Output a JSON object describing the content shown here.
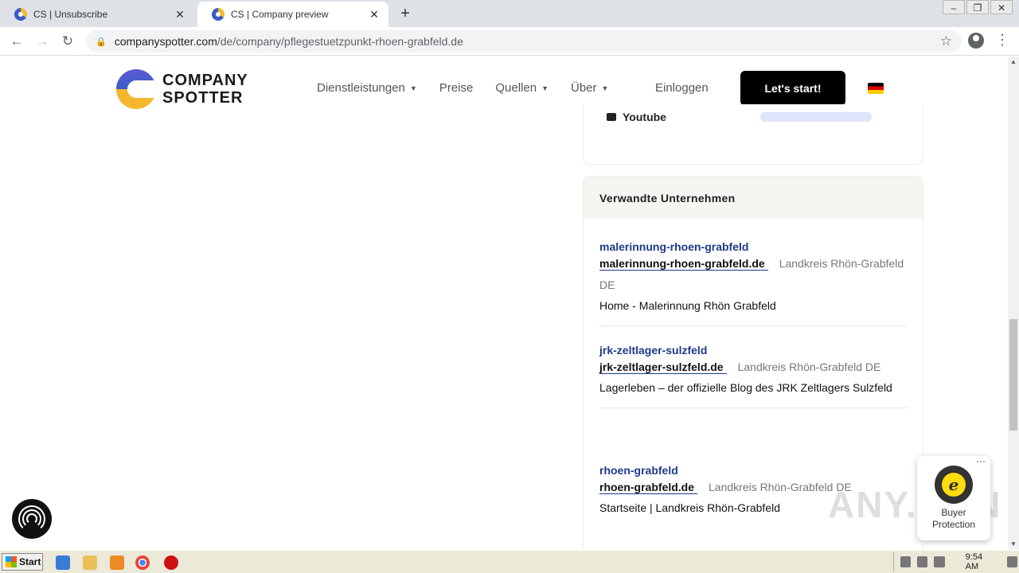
{
  "browser": {
    "tabs": [
      {
        "title": "CS | Unsubscribe",
        "active": false
      },
      {
        "title": "CS | Company preview",
        "active": true
      }
    ],
    "url_host": "companyspotter.com",
    "url_path": "/de/company/pflegestuetzpunkt-rhoen-grabfeld.de"
  },
  "site": {
    "logo_line1": "COMPANY",
    "logo_line2": "SPOTTER",
    "nav": [
      {
        "label": "Dienstleistungen",
        "caret": true
      },
      {
        "label": "Preise",
        "caret": false
      },
      {
        "label": "Quellen",
        "caret": true
      },
      {
        "label": "Über",
        "caret": true
      }
    ],
    "login": "Einloggen",
    "cta": "Let's start!",
    "language_flag": "de-flag-icon"
  },
  "social": {
    "youtube_label": "Youtube"
  },
  "related": {
    "title": "Verwandte Unternehmen",
    "entries": [
      {
        "name": "malerinnung-rhoen-grabfeld",
        "domain": "malerinnung-rhoen-grabfeld.de",
        "location": "Landkreis Rhön-Grabfeld DE",
        "description": "Home - Malerinnung Rhön Grabfeld"
      },
      {
        "name": "jrk-zeltlager-sulzfeld",
        "domain": "jrk-zeltlager-sulzfeld.de",
        "location": "Landkreis Rhön-Grabfeld DE",
        "description": "Lagerleben – der offizielle Blog des JRK Zeltlagers Sulzfeld"
      },
      {
        "name": "rhoen-grabfeld",
        "domain": "rhoen-grabfeld.de",
        "location": "Landkreis Rhön-Grabfeld DE",
        "description": "Startseite | Landkreis Rhön-Grabfeld"
      }
    ]
  },
  "widgets": {
    "trusted_line1": "Buyer",
    "trusted_line2": "Protection",
    "trusted_more": "⋯",
    "watermark": "ANY.RUN"
  },
  "taskbar": {
    "start": "Start",
    "clock": "9:54 AM"
  },
  "colors": {
    "link_blue": "#1e3a8a",
    "cta_bg": "#000000",
    "logo_blue": "#3b5cc4",
    "logo_yellow": "#f5b72e"
  }
}
